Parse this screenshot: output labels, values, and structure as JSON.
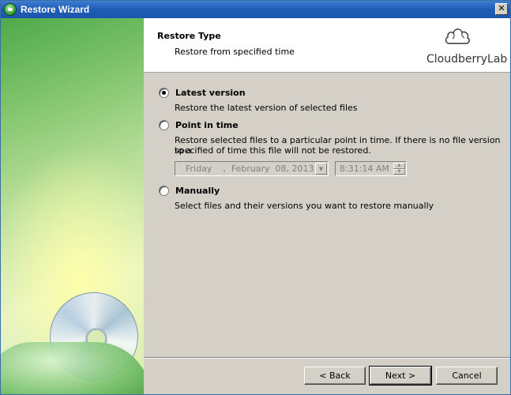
{
  "window": {
    "title": "Restore Wizard",
    "close_glyph": "✕"
  },
  "header": {
    "title": "Restore Type",
    "subtitle": "Restore from specified time",
    "logo_text": "CloudberryLab",
    "logo_icon": "cloud-icon"
  },
  "options": {
    "latest": {
      "label": "Latest version",
      "description": "Restore the latest version of selected files",
      "selected": true
    },
    "point_in_time": {
      "label": "Point in time",
      "description_line1": "Restore selected files to a particular point in time. If there is no file version to a",
      "description_line2": "specified of time this file will not be restored.",
      "selected": false,
      "date_value": "Friday    ,  February  08, 2013",
      "time_value": "8:31:14 AM"
    },
    "manually": {
      "label": "Manually",
      "description": "Select files and their versions you want to restore manually",
      "selected": false
    }
  },
  "buttons": {
    "back": "< Back",
    "next": "Next >",
    "cancel": "Cancel"
  },
  "colors": {
    "titlebar": "#1f5cb5",
    "face": "#d4d0c8",
    "header_bg": "#ffffff"
  }
}
